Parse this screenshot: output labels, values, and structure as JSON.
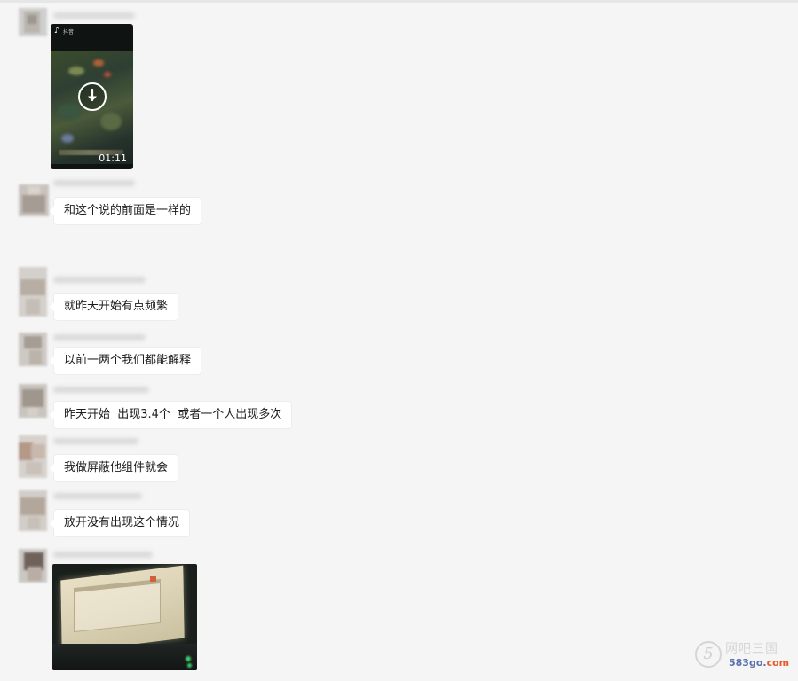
{
  "chat": {
    "video": {
      "duration": "01:11",
      "platform_icon": "tiktok-logo-icon",
      "platform_label": "抖音"
    },
    "messages": [
      {
        "text": "和这个说的前面是一样的"
      },
      {
        "text": "就昨天开始有点频繁"
      },
      {
        "text": "以前一两个我们都能解释"
      },
      {
        "text": "昨天开始  出现3.4个  或者一个人出现多次"
      },
      {
        "text": "我做屏蔽他组件就会"
      },
      {
        "text": "放开没有出现这个情况"
      }
    ]
  },
  "watermark": {
    "glyph": "5",
    "brand": "网吧三国",
    "site_main": "583go.",
    "site_tld": "com"
  },
  "colors": {
    "background": "#f5f5f5",
    "bubble": "#ffffff",
    "watermark_site": "#5a6fae",
    "watermark_dot": "#e85a2a"
  }
}
